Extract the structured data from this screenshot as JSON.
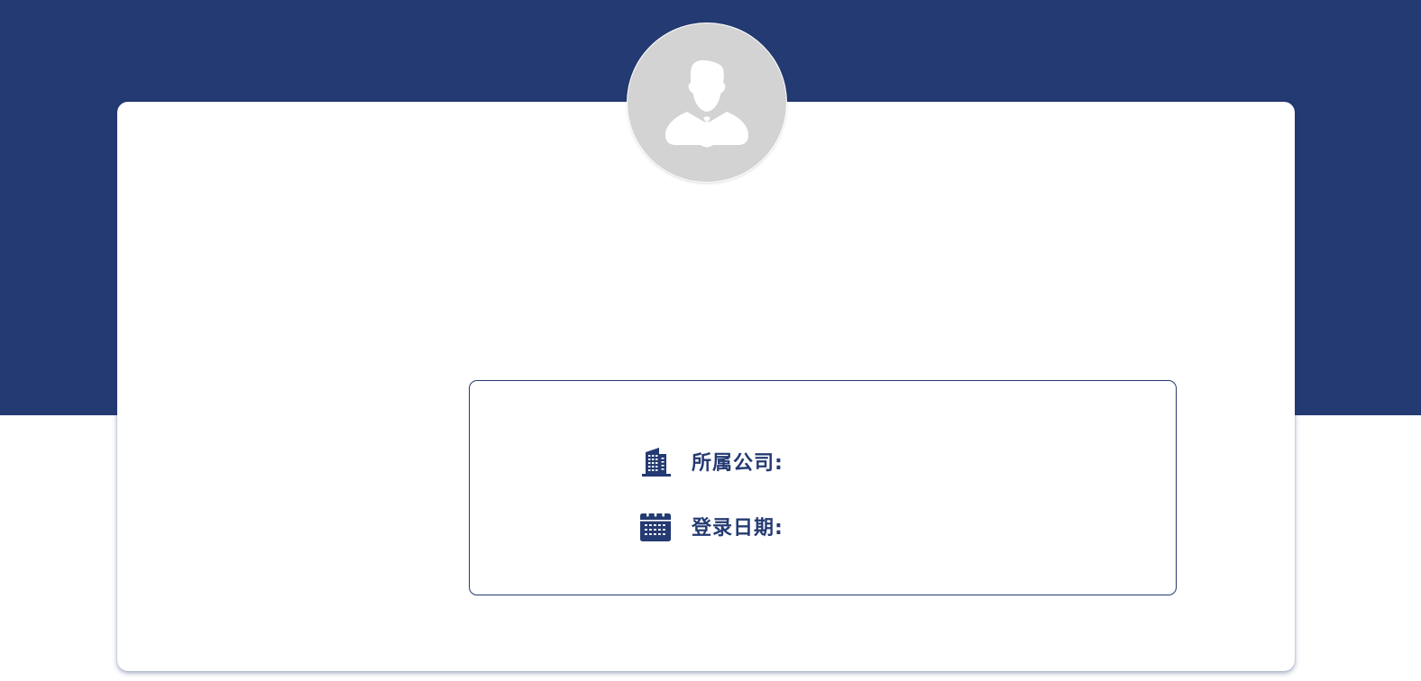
{
  "profile": {
    "avatar_icon": "user-avatar-icon",
    "avatar_bg_color": "#d3d3d3",
    "company_label": "所属公司:",
    "company_value": "",
    "company_icon": "building-icon",
    "login_date_label": "登录日期:",
    "login_date_value": "",
    "login_date_icon": "calendar-icon"
  },
  "theme": {
    "primary_color": "#243a72",
    "background_color": "#ffffff"
  }
}
